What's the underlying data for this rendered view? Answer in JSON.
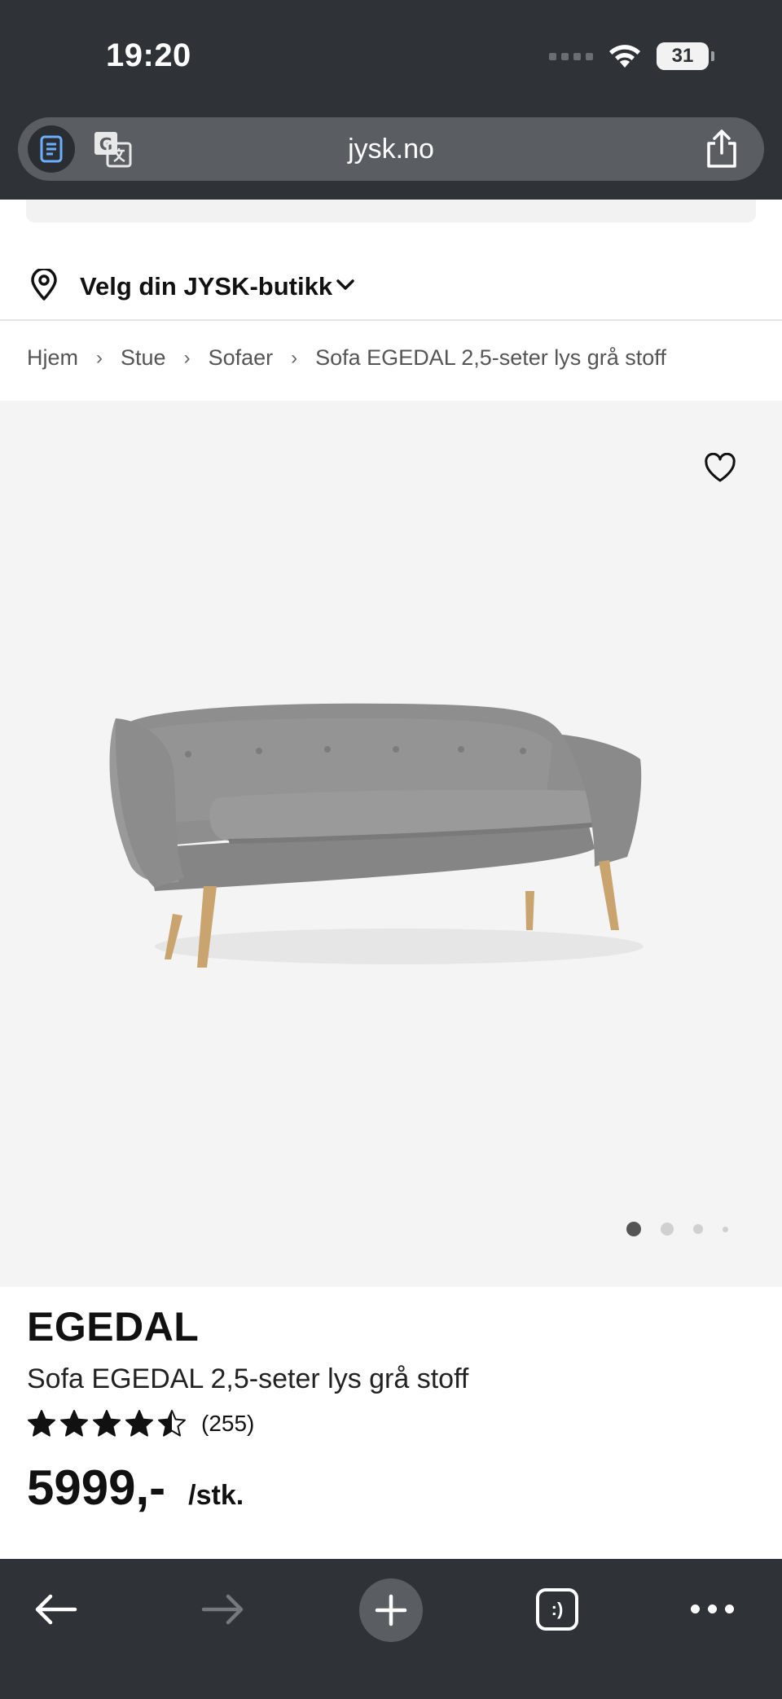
{
  "status_bar": {
    "time": "19:20",
    "battery": "31",
    "battery_fraction": 0.31,
    "icons": [
      "signal-icon",
      "wifi-icon",
      "battery-icon"
    ]
  },
  "browser": {
    "url": "jysk.no",
    "icons": [
      "reader-icon",
      "translate-icon",
      "share-icon"
    ]
  },
  "store_selector": {
    "label": "Velg din JYSK-butikk",
    "icons": [
      "location-pin-icon",
      "chevron-down-icon"
    ]
  },
  "breadcrumb": [
    "Hjem",
    "Stue",
    "Sofaer",
    "Sofa EGEDAL 2,5-seter lys grå stoff"
  ],
  "product": {
    "brand": "EGEDAL",
    "name": "Sofa EGEDAL 2,5-seter lys grå stoff",
    "rating": 4.5,
    "rating_max": 5,
    "review_count": "(255)",
    "price": "5999,-",
    "unit": "/stk.",
    "image": {
      "icon": "sofa-image",
      "slide_count": 4,
      "active_slide": 1
    },
    "favorite_icon": "heart-icon"
  },
  "toolbar": {
    "icons": [
      "back-arrow-icon",
      "forward-arrow-icon",
      "new-tab-plus-icon",
      "tabs-icon",
      "more-icon"
    ],
    "tabs_glyph": ":)"
  },
  "colors": {
    "chrome": "#2f3236",
    "urlbar": "#5a5e63",
    "image_bg": "#f4f4f4",
    "sofa": "#8f8f8f"
  }
}
